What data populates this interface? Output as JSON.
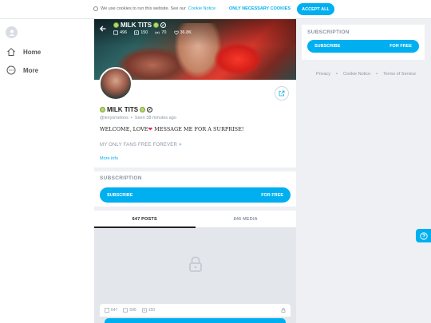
{
  "cookie": {
    "text": "We use cookies to run this website. See our",
    "link": "Cookie Notice",
    "necessary_label": "ONLY NECESSARY COOKIES",
    "accept_label": "ACCEPT ALL"
  },
  "nav": {
    "items": [
      {
        "label": "Home",
        "icon": "home-icon"
      },
      {
        "label": "More",
        "icon": "more-icon"
      }
    ]
  },
  "profile": {
    "cover_title": "MILK TITS",
    "stats": {
      "photos": "496",
      "videos": "150",
      "streams": "70",
      "likes": "36.8K"
    },
    "name": "MILK TITS",
    "handle": "@lexysmelons",
    "seen": "Seen 38 minutes ago",
    "bio_line1_a": "WELCOME, LOVE",
    "bio_line1_b": "MESSAGE ME FOR A SURPRISE!",
    "bio_line2": "MY ONLY FANS FREE FOREVER",
    "more_info": "More info"
  },
  "subscription": {
    "label": "SUBSCRIPTION",
    "button_left": "SUBSCRIBE",
    "button_right": "FOR FREE"
  },
  "tabs": [
    {
      "label": "647 POSTS",
      "active": true
    },
    {
      "label": "846 MEDIA",
      "active": false
    }
  ],
  "post": {
    "counts": {
      "posts": "647",
      "photos": "696",
      "videos": "150"
    }
  },
  "right": {
    "label": "SUBSCRIPTION",
    "button_left": "SUBSCRIBE",
    "button_right": "FOR FREE"
  },
  "footer": {
    "links": [
      "Privacy",
      "Cookie Notice",
      "Terms of Service"
    ]
  },
  "colors": {
    "accent": "#00aff0",
    "muted": "#8a96a3"
  }
}
